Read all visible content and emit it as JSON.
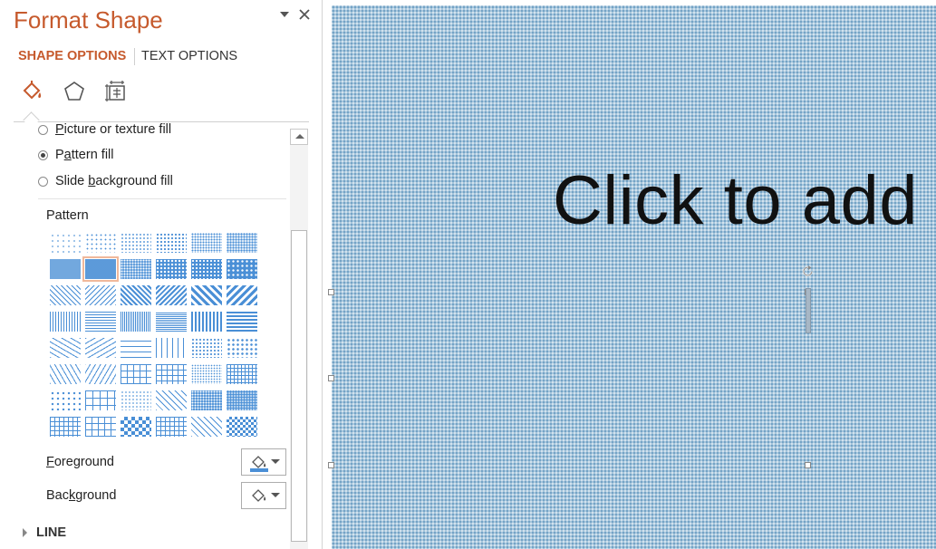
{
  "pane": {
    "title": "Format Shape",
    "tabs": {
      "shape": "SHAPE OPTIONS",
      "text": "TEXT OPTIONS"
    },
    "categories": [
      "fill-line-icon",
      "effects-icon",
      "size-properties-icon"
    ],
    "fill_options": [
      {
        "pre": "",
        "u": "P",
        "post": "icture or texture fill",
        "selected": false
      },
      {
        "pre": "P",
        "u": "a",
        "post": "ttern fill",
        "selected": true
      },
      {
        "pre": "Slide ",
        "u": "b",
        "post": "ackground fill",
        "selected": false
      }
    ],
    "pattern_label": "Pattern",
    "foreground": {
      "u": "F",
      "post": "oreground"
    },
    "background": {
      "pre": "Bac",
      "u": "k",
      "post": "ground"
    },
    "line_section": "LINE"
  },
  "slide": {
    "placeholder_text": "Click to add"
  },
  "colors": {
    "accent": "#c65a2d",
    "pattern_blue": "#4a8fd6",
    "slide_fill": "#a7c6dc"
  }
}
